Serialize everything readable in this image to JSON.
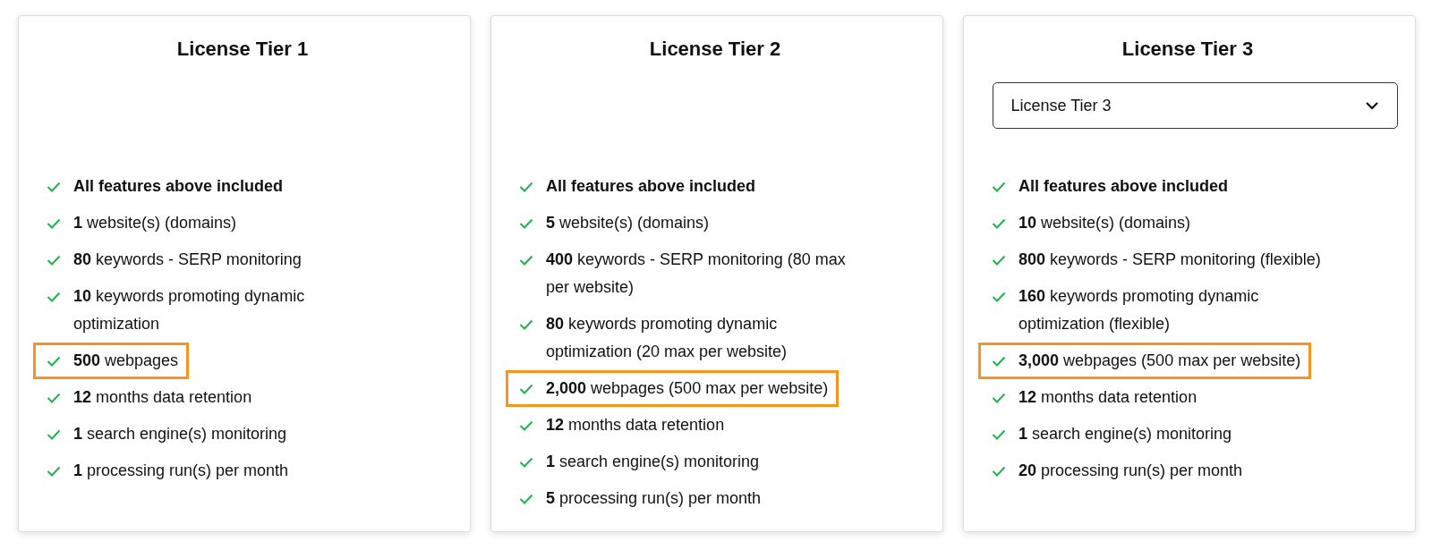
{
  "tiers": [
    {
      "title": "License Tier 1",
      "features": [
        {
          "text": "All features above included",
          "bold": true,
          "highlighted": false
        },
        {
          "text": "**1** website(s) (domains)",
          "bold": false,
          "highlighted": false
        },
        {
          "text": "**80** keywords - SERP monitoring",
          "bold": false,
          "highlighted": false
        },
        {
          "text": "**10** keywords promoting dynamic optimization",
          "bold": false,
          "highlighted": false
        },
        {
          "text": "**500** webpages",
          "bold": false,
          "highlighted": true
        },
        {
          "text": "**12** months data retention",
          "bold": false,
          "highlighted": false
        },
        {
          "text": "**1** search engine(s) monitoring",
          "bold": false,
          "highlighted": false
        },
        {
          "text": "**1** processing run(s) per month",
          "bold": false,
          "highlighted": false
        }
      ]
    },
    {
      "title": "License Tier 2",
      "features": [
        {
          "text": "All features above included",
          "bold": true,
          "highlighted": false
        },
        {
          "text": "**5** website(s) (domains)",
          "bold": false,
          "highlighted": false
        },
        {
          "text": "**400** keywords - SERP monitoring (80 max per website)",
          "bold": false,
          "highlighted": false
        },
        {
          "text": "**80** keywords promoting dynamic optimization (20 max per website)",
          "bold": false,
          "highlighted": false
        },
        {
          "text": "**2,000** webpages (500 max per website)",
          "bold": false,
          "highlighted": true
        },
        {
          "text": "**12** months data retention",
          "bold": false,
          "highlighted": false
        },
        {
          "text": "**1** search engine(s) monitoring",
          "bold": false,
          "highlighted": false
        },
        {
          "text": "**5** processing run(s) per month",
          "bold": false,
          "highlighted": false
        }
      ]
    },
    {
      "title": "License Tier 3",
      "dropdown": {
        "value": "License Tier 3"
      },
      "features": [
        {
          "text": "All features above included",
          "bold": true,
          "highlighted": false
        },
        {
          "text": "**10** website(s) (domains)",
          "bold": false,
          "highlighted": false
        },
        {
          "text": "**800** keywords - SERP monitoring (flexible)",
          "bold": false,
          "highlighted": false
        },
        {
          "text": "**160** keywords promoting dynamic optimization (flexible)",
          "bold": false,
          "highlighted": false
        },
        {
          "text": "**3,000** webpages (500 max per website)",
          "bold": false,
          "highlighted": true
        },
        {
          "text": "**12** months data retention",
          "bold": false,
          "highlighted": false
        },
        {
          "text": "**1** search engine(s) monitoring",
          "bold": false,
          "highlighted": false
        },
        {
          "text": "**20** processing run(s) per month",
          "bold": false,
          "highlighted": false
        }
      ]
    }
  ]
}
